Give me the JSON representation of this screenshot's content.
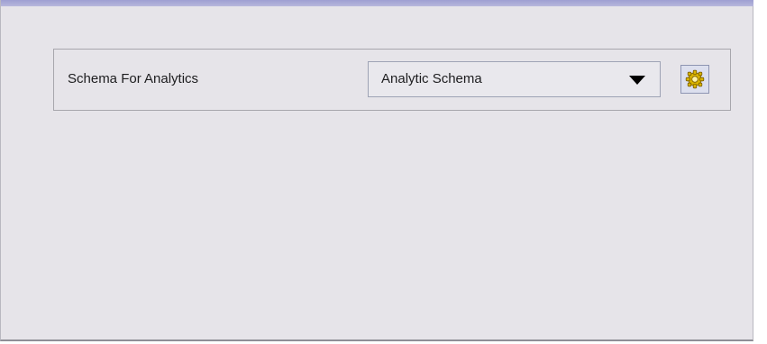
{
  "form": {
    "schema_label": "Schema For Analytics",
    "schema_select": {
      "selected": "Analytic Schema",
      "arrow_icon": "triangle-down"
    },
    "settings_button_icon": "gear-icon"
  },
  "colors": {
    "panel_background": "#e6e4e9",
    "title_strip": "#9e9fd2",
    "gear_gold": "#d9b400"
  }
}
